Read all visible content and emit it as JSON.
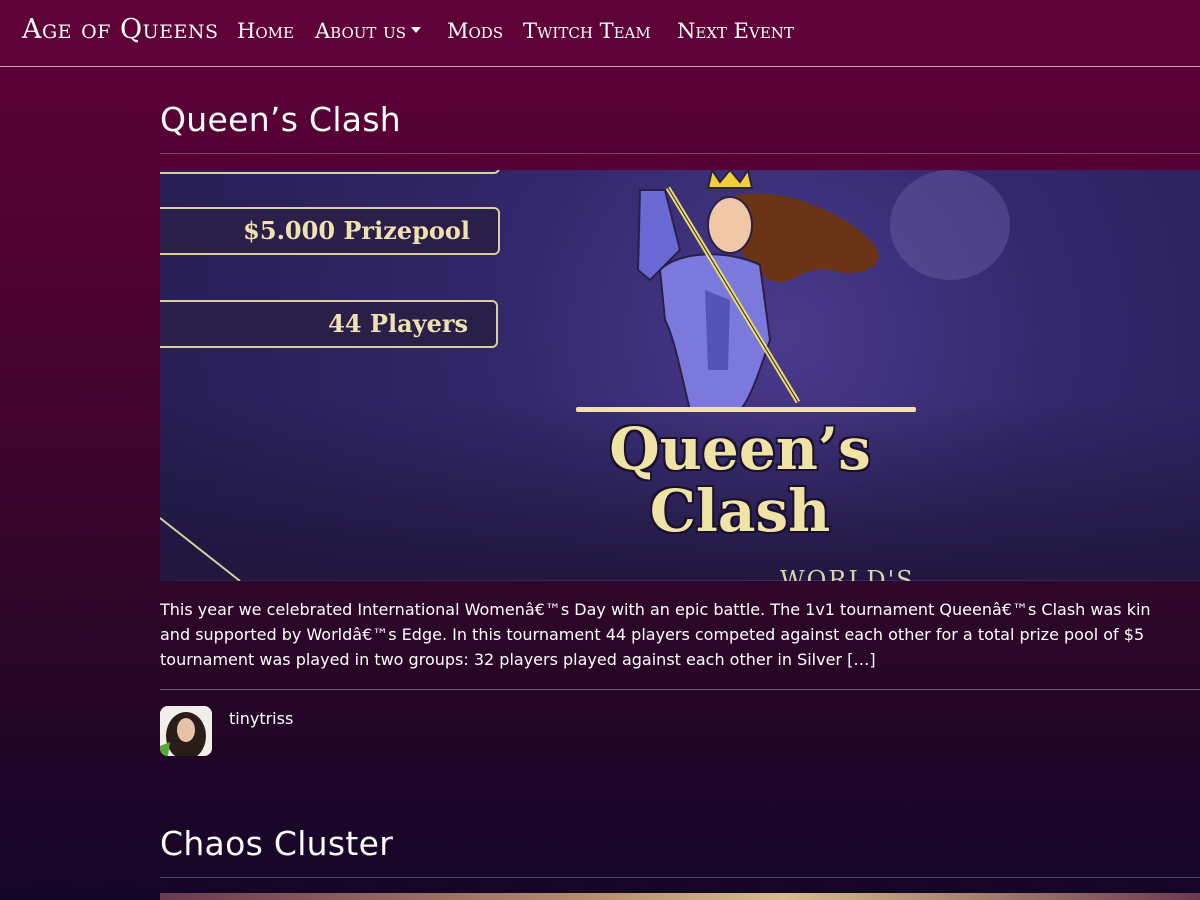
{
  "nav": {
    "brand": "Age of Queens",
    "items": [
      {
        "label": "Home"
      },
      {
        "label": "About us"
      },
      {
        "label": "Mods"
      },
      {
        "label": "Twitch Team"
      },
      {
        "label": "Next Event"
      }
    ]
  },
  "posts": [
    {
      "title": "Queen’s Clash",
      "banner": {
        "pills": [
          "$5.000 Prizepool",
          "44 Players"
        ],
        "title": "Queen’s Clash",
        "subtitle": "WORLD'S"
      },
      "excerpt": [
        "This year we celebrated International Womenâ€™s Day with an epic battle. The 1v1 tournament Queenâ€™s Clash was kin",
        "and supported by Worldâ€™s Edge. In this tournament 44 players competed against each other for a total prize pool of $5",
        "tournament was played in two groups: 32 players played against each other in Silver […]"
      ],
      "author": "tinytriss"
    },
    {
      "title": "Chaos Cluster"
    }
  ],
  "colors": {
    "nav_bg": "#5e0238",
    "accent_gold": "#efe2b0"
  }
}
